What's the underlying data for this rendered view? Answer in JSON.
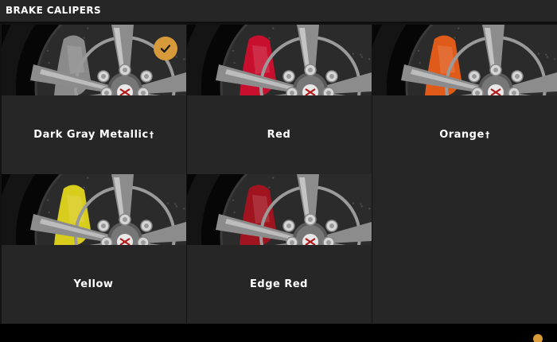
{
  "section": {
    "title": "BRAKE CALIPERS"
  },
  "accent_color": "#d69a3a",
  "options": [
    {
      "label": "Dark Gray Metallic",
      "mark": "†",
      "caliper_color": "#8a8a8a",
      "selected": true
    },
    {
      "label": "Red",
      "mark": "",
      "caliper_color": "#c8102e",
      "selected": false
    },
    {
      "label": "Orange",
      "mark": "†",
      "caliper_color": "#e05a1a",
      "selected": false
    },
    {
      "label": "Yellow",
      "mark": "",
      "caliper_color": "#d8cc1c",
      "selected": false
    },
    {
      "label": "Edge Red",
      "mark": "",
      "caliper_color": "#a0141f",
      "selected": false
    }
  ],
  "selected_icon": "checkmark-icon"
}
